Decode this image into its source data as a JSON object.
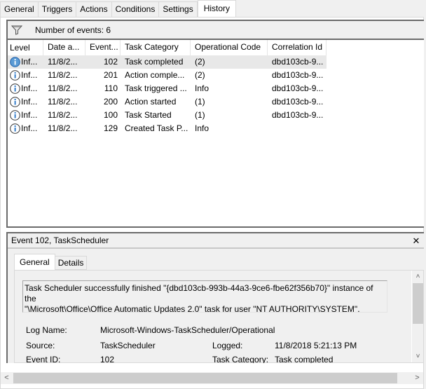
{
  "tabs": [
    {
      "label": "General"
    },
    {
      "label": "Triggers"
    },
    {
      "label": "Actions"
    },
    {
      "label": "Conditions"
    },
    {
      "label": "Settings"
    },
    {
      "label": "History",
      "active": true
    }
  ],
  "events": {
    "filter_icon": "filter-icon",
    "count_text": "Number of events: 6",
    "columns": [
      "Level",
      "Date a...",
      "Event...",
      "Task Category",
      "Operational Code",
      "Correlation Id"
    ],
    "rows": [
      {
        "level": "Inf...",
        "date": "11/8/2...",
        "event": "102",
        "category": "Task completed",
        "opcode": "(2)",
        "correlation": "dbd103cb-9...",
        "selected": true
      },
      {
        "level": "Inf...",
        "date": "11/8/2...",
        "event": "201",
        "category": "Action comple...",
        "opcode": "(2)",
        "correlation": "dbd103cb-9..."
      },
      {
        "level": "Inf...",
        "date": "11/8/2...",
        "event": "110",
        "category": "Task triggered ...",
        "opcode": "Info",
        "correlation": "dbd103cb-9..."
      },
      {
        "level": "Inf...",
        "date": "11/8/2...",
        "event": "200",
        "category": "Action started",
        "opcode": "(1)",
        "correlation": "dbd103cb-9..."
      },
      {
        "level": "Inf...",
        "date": "11/8/2...",
        "event": "100",
        "category": "Task Started",
        "opcode": "(1)",
        "correlation": "dbd103cb-9..."
      },
      {
        "level": "Inf...",
        "date": "11/8/2...",
        "event": "129",
        "category": "Created Task P...",
        "opcode": "Info",
        "correlation": ""
      }
    ]
  },
  "details": {
    "title": "Event 102, TaskScheduler",
    "close_label": "✕",
    "tabs": [
      {
        "label": "General",
        "active": true
      },
      {
        "label": "Details"
      }
    ],
    "message_line1": "Task Scheduler successfully finished \"{dbd103cb-993b-44a3-9ce6-fbe62f356b70}\" instance of the",
    "message_line2": "\"\\Microsoft\\Office\\Office Automatic Updates 2.0\" task for user \"NT AUTHORITY\\SYSTEM\".",
    "fields": {
      "log_name_label": "Log Name:",
      "log_name_value": "Microsoft-Windows-TaskScheduler/Operational",
      "source_label": "Source:",
      "source_value": "TaskScheduler",
      "logged_label": "Logged:",
      "logged_value": "11/8/2018 5:21:13 PM",
      "event_id_label": "Event ID:",
      "event_id_value": "102",
      "task_category_label": "Task Category:",
      "task_category_value": "Task completed"
    }
  },
  "scroll": {
    "up": "˄",
    "down": "˅",
    "left": "<",
    "right": ">"
  }
}
